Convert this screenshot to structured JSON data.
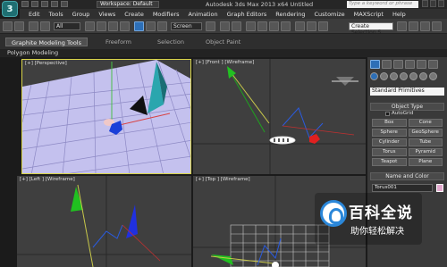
{
  "app": {
    "logo": "3",
    "workspace": "Workspace: Default",
    "title": "Autodesk 3ds Max  2013 x64      Untitled",
    "search_placeholder": "Type a keyword or phrase"
  },
  "menu": [
    "Edit",
    "Tools",
    "Group",
    "Views",
    "Create",
    "Modifiers",
    "Animation",
    "Graph Editors",
    "Rendering",
    "Customize",
    "MAXScript",
    "Help"
  ],
  "toolbar": {
    "filter": "All",
    "coord_system": "Screen",
    "selection_set": "Create Selection S"
  },
  "ribbon": {
    "tabs": [
      "Graphite Modeling Tools",
      "Freeform",
      "Selection",
      "Object Paint"
    ],
    "active_tab": "Graphite Modeling Tools",
    "panel": "Polygon Modeling"
  },
  "viewports": {
    "perspective": "[+] [Perspective]",
    "front": "[+] [Front ] [Wireframe]",
    "left": "[+] [Left ] [Wireframe]",
    "top": "[+] [Top ] [Wireframe]"
  },
  "command_panel": {
    "category": "Standard Primitives",
    "object_type_header": "Object Type",
    "autogrid": "AutoGrid",
    "buttons": [
      "Box",
      "Cone",
      "Sphere",
      "GeoSphere",
      "Cylinder",
      "Tube",
      "Torus",
      "Pyramid",
      "Teapot",
      "Plane"
    ],
    "name_color_header": "Name and Color",
    "object_name": "Torus001",
    "object_color": "#e3a9ce"
  },
  "watermark": {
    "line1": "百科全说",
    "line2": "助你轻松解决"
  }
}
